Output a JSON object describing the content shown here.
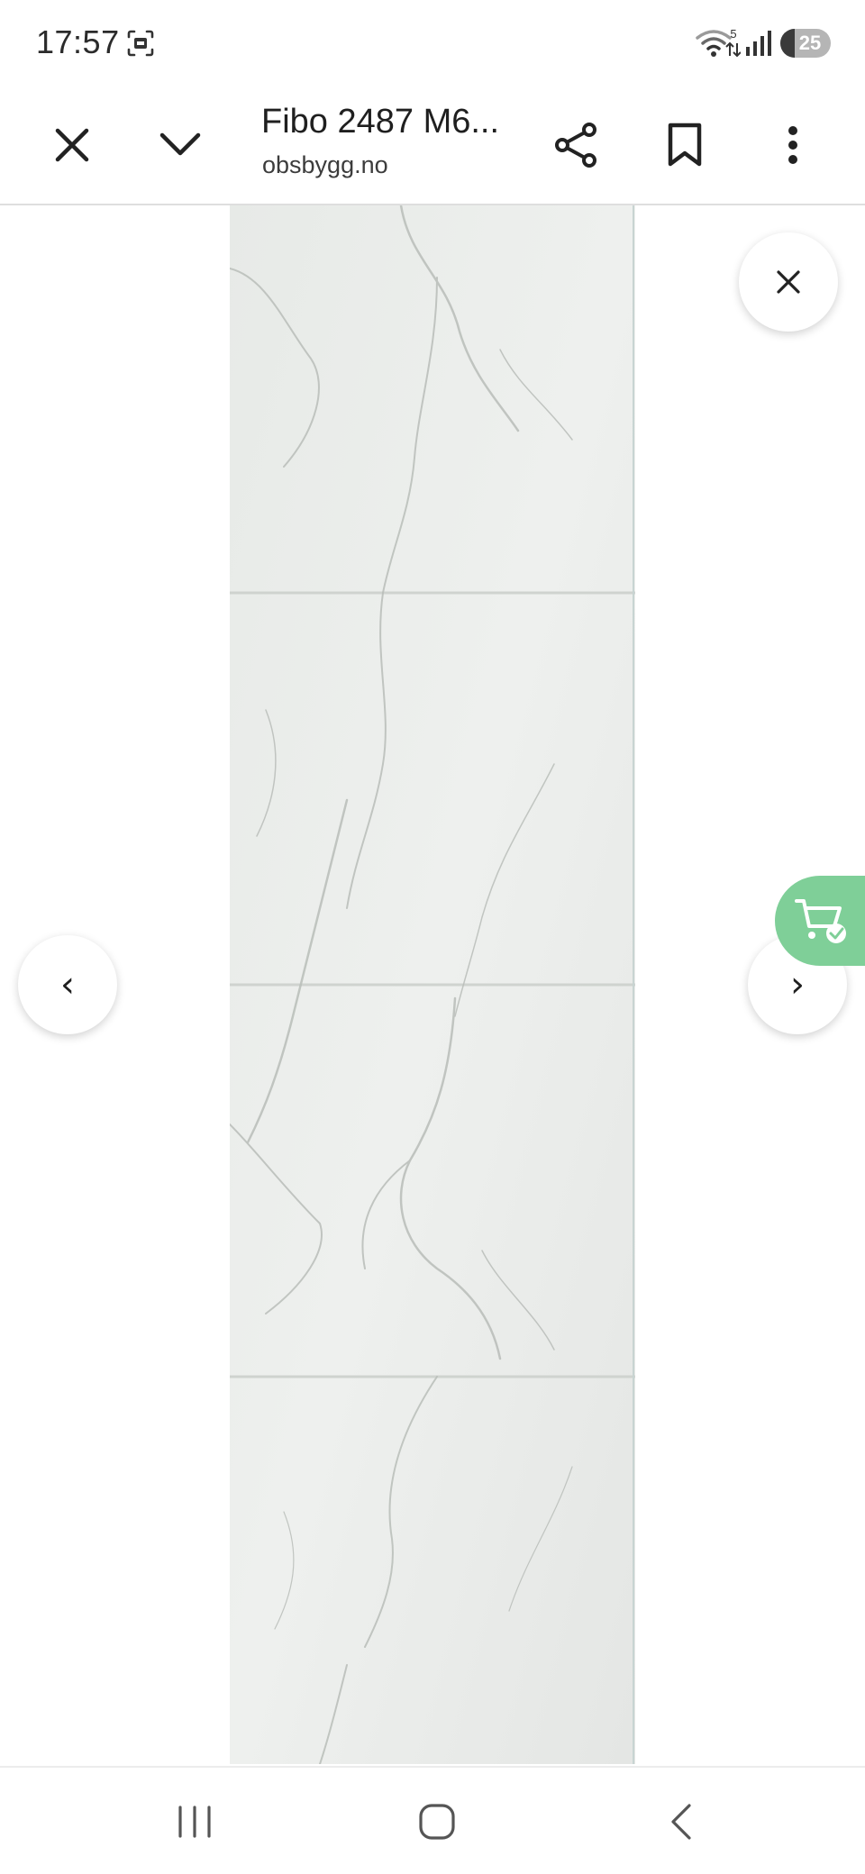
{
  "status_bar": {
    "time": "17:57",
    "network_label": "5",
    "battery": "25"
  },
  "toolbar": {
    "title": "Fibo 2487 M6...",
    "domain": "obsbygg.no"
  },
  "viewer": {
    "prev_glyph": "‹",
    "next_glyph": "›"
  },
  "icons": {
    "status": [
      "screenshot-icon",
      "wifi-icon",
      "signal-icon",
      "battery-icon"
    ],
    "toolbar": [
      "close-icon",
      "chevron-down-icon",
      "share-icon",
      "bookmark-icon",
      "more-vert-icon"
    ],
    "viewer": [
      "close-icon",
      "chevron-left-icon",
      "chevron-right-icon",
      "cart-check-icon"
    ],
    "nav": [
      "recent-apps-icon",
      "home-icon",
      "back-icon"
    ]
  },
  "colors": {
    "cart_accent": "#7fcf98",
    "tile_base": "#ebeeeb",
    "divider": "#dedede"
  }
}
